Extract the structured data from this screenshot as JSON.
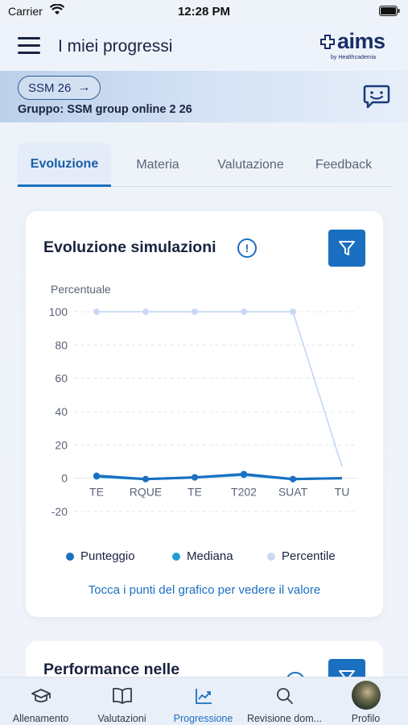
{
  "status_bar": {
    "carrier": "Carrier",
    "time": "12:28 PM"
  },
  "header": {
    "title": "I miei progressi",
    "logo_text": "aims",
    "logo_sub": "by Healthcademia"
  },
  "group_bar": {
    "chip_label": "SSM 26",
    "group_text": "Gruppo: SSM group online 2 26"
  },
  "tabs": [
    {
      "label": "Evoluzione",
      "active": true
    },
    {
      "label": "Materia",
      "active": false
    },
    {
      "label": "Valutazione",
      "active": false
    },
    {
      "label": "Feedback",
      "active": false
    }
  ],
  "card": {
    "title": "Evoluzione simulazioni",
    "info_symbol": "!",
    "hint": "Tocca i punti del grafico per vedere il valore",
    "legend": [
      {
        "label": "Punteggio",
        "color": "#1a6fc0"
      },
      {
        "label": "Mediana",
        "color": "#1fa0d0"
      },
      {
        "label": "Percentile",
        "color": "#c9d9f5"
      }
    ]
  },
  "chart_data": {
    "type": "line",
    "ylabel": "Percentuale",
    "ylim": [
      -20,
      100
    ],
    "yticks": [
      100,
      80,
      60,
      40,
      20,
      0,
      -20
    ],
    "categories": [
      "TE",
      "RQUE",
      "TE",
      "T202",
      "SUAT",
      "TU"
    ],
    "grid": true,
    "series": [
      {
        "name": "Percentile",
        "color": "#c9d9f5",
        "values": [
          100,
          100,
          100,
          100,
          100,
          7
        ]
      },
      {
        "name": "Mediana",
        "color": "#1fa0d0",
        "values": [
          1,
          -0.5,
          0.5,
          2,
          -0.5,
          0
        ]
      },
      {
        "name": "Punteggio",
        "color": "#1a6fc0",
        "values": [
          1.5,
          -0.5,
          0.5,
          2.5,
          -0.5,
          0
        ]
      }
    ]
  },
  "card2": {
    "title": "Performance nelle"
  },
  "bottom_nav": [
    {
      "label": "Allenamento",
      "icon": "graduation-cap-icon",
      "active": false
    },
    {
      "label": "Valutazioni",
      "icon": "book-icon",
      "active": false
    },
    {
      "label": "Progressione",
      "icon": "chart-icon",
      "active": true
    },
    {
      "label": "Revisione dom...",
      "icon": "search-icon",
      "active": false
    },
    {
      "label": "Profilo",
      "icon": "avatar",
      "active": false
    }
  ]
}
